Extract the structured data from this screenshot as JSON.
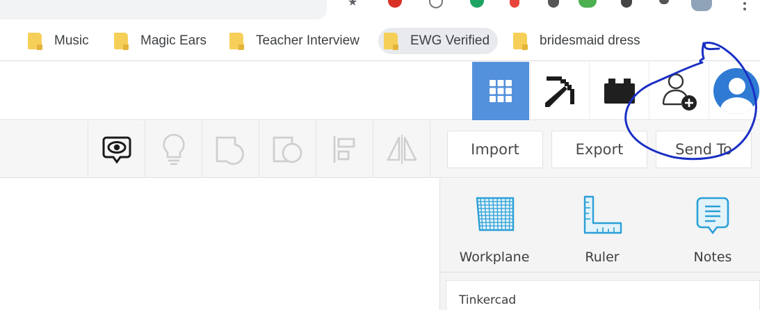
{
  "bookmarks": [
    {
      "label": "Music"
    },
    {
      "label": "Magic Ears"
    },
    {
      "label": "Teacher Interview"
    },
    {
      "label": "EWG Verified",
      "active": true
    },
    {
      "label": "bridesmaid dress"
    }
  ],
  "app_bar": {
    "icons": [
      "grid-view-icon",
      "pickaxe-icon",
      "briefcase-icon",
      "add-user-icon",
      "avatar-icon"
    ],
    "active_color": "#5391dc",
    "avatar_color": "#2f7bd4"
  },
  "toolbar": {
    "icons": [
      "show-all-icon",
      "lightbulb-icon",
      "group-icon",
      "ungroup-icon",
      "align-icon",
      "mirror-icon"
    ],
    "import_label": "Import",
    "export_label": "Export",
    "send_to_label": "Send To"
  },
  "side_panel": {
    "items": [
      {
        "label": "Workplane",
        "icon": "workplane-icon"
      },
      {
        "label": "Ruler",
        "icon": "ruler-icon"
      },
      {
        "label": "Notes",
        "icon": "notes-icon"
      }
    ],
    "card_title": "Tinkercad",
    "accent_color": "#2a9fd6"
  },
  "annotation": {
    "color": "#1a2fc4"
  }
}
